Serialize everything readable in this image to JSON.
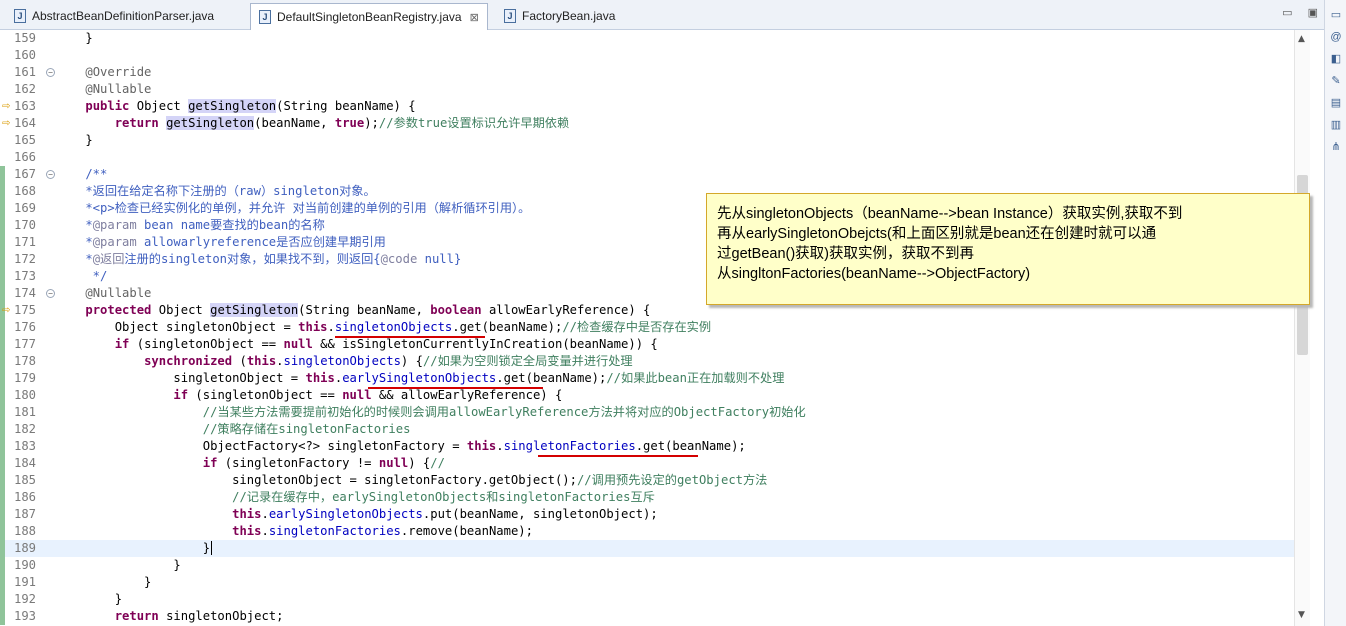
{
  "tabs": [
    {
      "label": "AbstractBeanDefinitionParser.java",
      "active": false
    },
    {
      "label": "DefaultSingletonBeanRegistry.java",
      "active": true,
      "close": "⊠"
    },
    {
      "label": "FactoryBean.java",
      "active": false
    }
  ],
  "window_buttons": {
    "minimize": "▭",
    "maximize": "▣"
  },
  "note": {
    "lines": [
      "先从singletonObjects（beanName-->bean Instance）获取实例,获取不到",
      "再从earlySingletonObejcts(和上面区别就是bean还在创建时就可以通",
      "过getBean()获取)获取实例，获取不到再",
      "从singltonFactories(beanName-->ObjectFactory)"
    ]
  },
  "code_lines": [
    {
      "n": "159",
      "t": "    }"
    },
    {
      "n": "160",
      "t": ""
    },
    {
      "n": "161",
      "t": "    @Override"
    },
    {
      "n": "162",
      "t": "    @Nullable"
    },
    {
      "n": "163",
      "t": "    public Object getSingleton(String beanName) {"
    },
    {
      "n": "164",
      "t": "        return getSingleton(beanName, true);//参数true设置标识允许早期依赖"
    },
    {
      "n": "165",
      "t": "    }"
    },
    {
      "n": "166",
      "t": ""
    },
    {
      "n": "167",
      "t": "    /**"
    },
    {
      "n": "168",
      "t": "    *返回在给定名称下注册的（raw）singleton对象。"
    },
    {
      "n": "169",
      "t": "    *<p>检查已经实例化的单例，并允许 对当前创建的单例的引用（解析循环引用）。"
    },
    {
      "n": "170",
      "t": "    *@param bean name要查找的bean的名称"
    },
    {
      "n": "171",
      "t": "    *@param allowarlyreference是否应创建早期引用"
    },
    {
      "n": "172",
      "t": "    *@返回注册的singleton对象，如果找不到，则返回{@code null}"
    },
    {
      "n": "173",
      "t": "     */"
    },
    {
      "n": "174",
      "t": "    @Nullable"
    },
    {
      "n": "175",
      "t": "    protected Object getSingleton(String beanName, boolean allowEarlyReference) {"
    },
    {
      "n": "176",
      "t": "        Object singletonObject = this.singletonObjects.get(beanName);//检查缓存中是否存在实例"
    },
    {
      "n": "177",
      "t": "        if (singletonObject == null && isSingletonCurrentlyInCreation(beanName)) {"
    },
    {
      "n": "178",
      "t": "            synchronized (this.singletonObjects) {//如果为空则锁定全局变量并进行处理"
    },
    {
      "n": "179",
      "t": "                singletonObject = this.earlySingletonObjects.get(beanName);//如果此bean正在加载则不处理"
    },
    {
      "n": "180",
      "t": "                if (singletonObject == null && allowEarlyReference) {"
    },
    {
      "n": "181",
      "t": "                    //当某些方法需要提前初始化的时候则会调用allowEarlyReference方法并将对应的ObjectFactory初始化"
    },
    {
      "n": "182",
      "t": "                    //策略存储在singletonFactories"
    },
    {
      "n": "183",
      "t": "                    ObjectFactory<?> singletonFactory = this.singletonFactories.get(beanName);"
    },
    {
      "n": "184",
      "t": "                    if (singletonFactory != null) {//"
    },
    {
      "n": "185",
      "t": "                        singletonObject = singletonFactory.getObject();//调用预先设定的getObject方法"
    },
    {
      "n": "186",
      "t": "                        //记录在缓存中，earlySingletonObjects和singletonFactories互斥"
    },
    {
      "n": "187",
      "t": "                        this.earlySingletonObjects.put(beanName, singletonObject);"
    },
    {
      "n": "188",
      "t": "                        this.singletonFactories.remove(beanName);"
    },
    {
      "n": "189",
      "t": "                    }"
    },
    {
      "n": "190",
      "t": "                }"
    },
    {
      "n": "191",
      "t": "            }"
    },
    {
      "n": "192",
      "t": "        }"
    },
    {
      "n": "193",
      "t": "        return singletonObject;"
    }
  ]
}
